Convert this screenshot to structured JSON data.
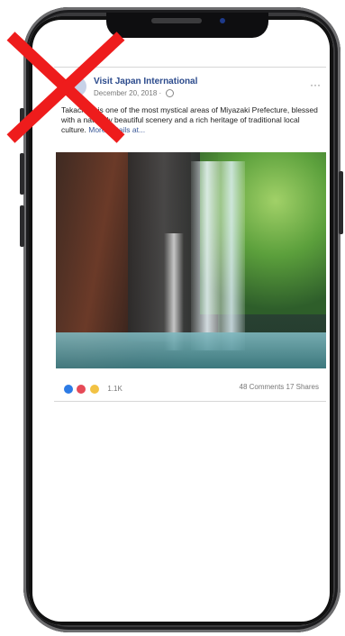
{
  "post": {
    "page_name": "Visit Japan International",
    "date": "December 20, 2018 ·",
    "text": "Takachiho is one of the most mystical areas of Miyazaki Prefecture, blessed with a naturally beautiful scenery and a rich heritage of traditional local culture.",
    "tags": "More details at...",
    "reaction_count": "1.1K",
    "share_stats": "48 Comments  17 Shares"
  },
  "colors": {
    "accent": "#2b4a8c",
    "x_mark": "#ee1c1c"
  }
}
